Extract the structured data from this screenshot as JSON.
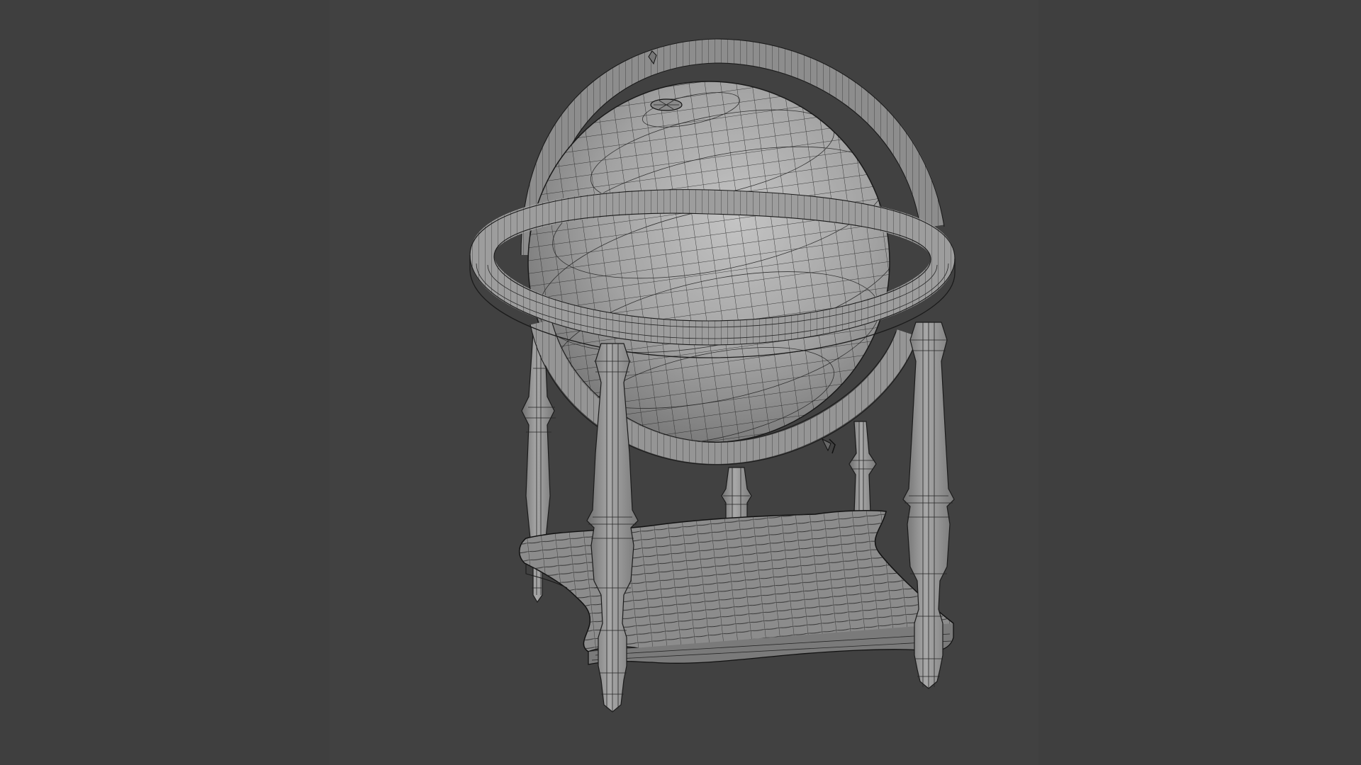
{
  "viewport": {
    "background_color": "#3f3f3f",
    "shading": "solid+wireframe",
    "mesh_color": "#9a9a9a",
    "wire_color": "#1b1b1b"
  },
  "scene": {
    "object_icon": "globe-stand-model"
  }
}
